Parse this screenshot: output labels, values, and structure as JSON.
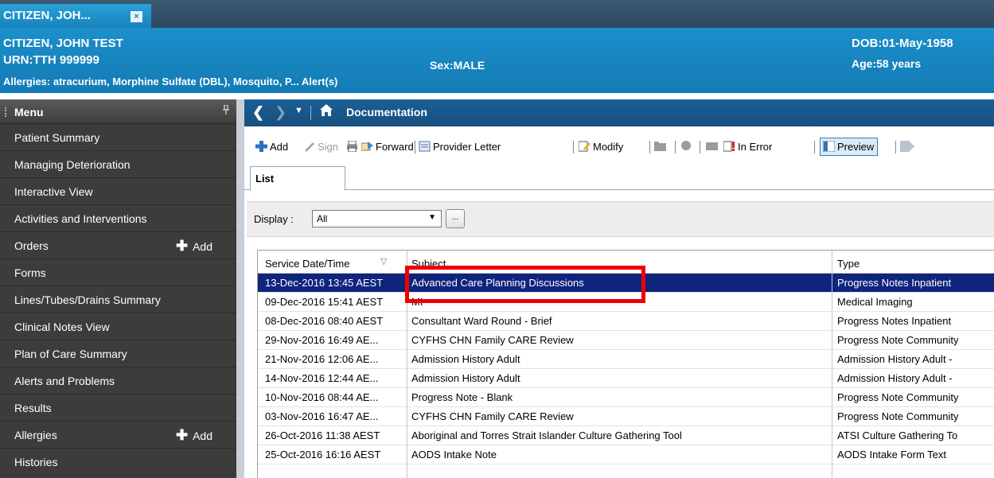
{
  "patient_tab": {
    "label": "CITIZEN, JOH...",
    "close_glyph": "×"
  },
  "banner": {
    "name": "CITIZEN, JOHN TEST",
    "urn": "URN:TTH 999999",
    "sex": "Sex:MALE",
    "dob": "DOB:01-May-1958",
    "age": "Age:58 years",
    "allergies": "Allergies: atracurium, Morphine Sulfate (DBL), Mosquito, P... Alert(s)"
  },
  "menu": {
    "title": "Menu",
    "pin_glyph": "ᵖ",
    "items": [
      {
        "label": "Patient Summary"
      },
      {
        "label": "Managing Deterioration"
      },
      {
        "label": "Interactive View"
      },
      {
        "label": "Activities and Interventions"
      },
      {
        "label": "Orders",
        "add": "Add"
      },
      {
        "label": "Forms"
      },
      {
        "label": "Lines/Tubes/Drains Summary"
      },
      {
        "label": "Clinical Notes View"
      },
      {
        "label": "Plan of Care Summary"
      },
      {
        "label": "Alerts and Problems"
      },
      {
        "label": "Results"
      },
      {
        "label": "Allergies",
        "add": "Add"
      },
      {
        "label": "Histories"
      }
    ]
  },
  "nav": {
    "title": "Documentation",
    "back_icon": "chevron-left-icon",
    "home_icon": "home-icon"
  },
  "toolbar": {
    "add": "Add",
    "sign": "Sign",
    "forward": "Forward",
    "provider_letter": "Provider Letter",
    "modify": "Modify",
    "in_error": "In Error",
    "preview": "Preview"
  },
  "tabs": {
    "list": "List"
  },
  "filter": {
    "display_label": "Display :",
    "display_value": "All",
    "more_label": "..."
  },
  "table": {
    "columns": [
      "Service Date/Time",
      "Subject",
      "Type"
    ],
    "rows": [
      [
        "13-Dec-2016 13:45 AEST",
        "Advanced Care Planning Discussions",
        "Progress Notes Inpatient"
      ],
      [
        "09-Dec-2016 15:41 AEST",
        "MI",
        "Medical Imaging"
      ],
      [
        "08-Dec-2016 08:40 AEST",
        "Consultant Ward Round - Brief",
        "Progress Notes Inpatient"
      ],
      [
        "29-Nov-2016 16:49 AE...",
        "CYFHS CHN Family CARE Review",
        "Progress Note Community"
      ],
      [
        "21-Nov-2016 12:06 AE...",
        "Admission History Adult",
        "Admission History Adult -"
      ],
      [
        "14-Nov-2016 12:44 AE...",
        "Admission History Adult",
        "Admission History Adult -"
      ],
      [
        "10-Nov-2016 08:44 AE...",
        "Progress Note - Blank",
        "Progress Note Community"
      ],
      [
        "03-Nov-2016 16:47 AE...",
        "CYFHS CHN Family CARE Review",
        "Progress Note Community"
      ],
      [
        "26-Oct-2016 11:38 AEST",
        "Aboriginal and Torres Strait Islander Culture Gathering Tool",
        "ATSI Culture Gathering To"
      ],
      [
        "25-Oct-2016 16:16 AEST",
        "AODS Intake Note",
        "AODS Intake Form Text"
      ]
    ]
  },
  "colors": {
    "selected_row": "#0f247c",
    "highlight": "#ee0000",
    "banner": "#1c8fcb"
  }
}
